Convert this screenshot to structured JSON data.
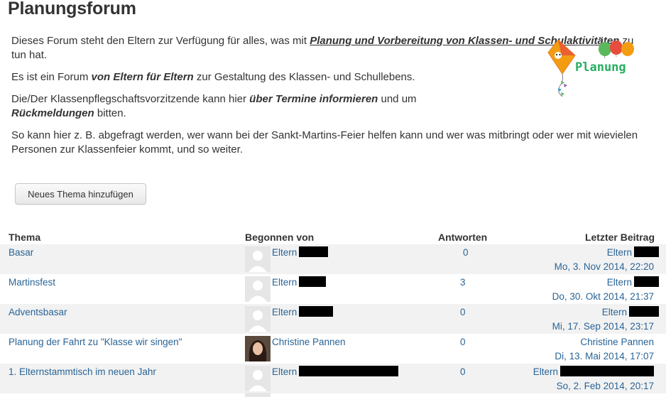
{
  "title": "Planungsforum",
  "intro": {
    "p1_a": "Dieses Forum steht den Eltern zur Verfügung für alles, was mit ",
    "p1_b": "Planung und Vorbereitung von Klassen- und Schulaktivitäten",
    "p1_c": " zu tun hat.",
    "p2_a": "Es ist ein Forum ",
    "p2_b": "von Eltern für Eltern",
    "p2_c": " zur Gestaltung des Klassen- und Schullebens.",
    "p3_a": "Die/Der Klassenpflegschaftsvorzitzende kann hier ",
    "p3_b": "über Termine informieren",
    "p3_c": " und um ",
    "p3_d": "Rückmeldungen",
    "p3_e": " bitten.",
    "p4": "So kann hier z. B. abgefragt werden, wer wann bei der Sankt-Martins-Feier helfen kann und wer was mitbringt oder wer mit wievielen Personen zur Klassenfeier kommt, und so weiter."
  },
  "logo_text": "Planung",
  "new_topic_button": "Neues Thema hinzufügen",
  "table": {
    "headers": {
      "topic": "Thema",
      "started_by": "Begonnen von",
      "replies": "Antworten",
      "last_post": "Letzter Beitrag"
    },
    "rows": [
      {
        "topic": "Basar",
        "author": "Eltern",
        "replies": "0",
        "last_author": "Eltern",
        "last_date": "Mo, 3. Nov 2014, 22:20"
      },
      {
        "topic": "Martinsfest",
        "author": "Eltern",
        "replies": "3",
        "last_author": "Eltern",
        "last_date": "Do, 30. Okt 2014, 21:37"
      },
      {
        "topic": "Adventsbasar",
        "author": "Eltern",
        "replies": "0",
        "last_author": "Eltern",
        "last_date": "Mi, 17. Sep 2014, 23:17"
      },
      {
        "topic": "Planung der Fahrt zu \"Klasse wir singen\"",
        "author": "Christine Pannen",
        "replies": "0",
        "last_author": "Christine Pannen",
        "last_date": "Di, 13. Mai 2014, 17:07"
      },
      {
        "topic": "1. Elternstammtisch im neuen Jahr",
        "author": "Eltern",
        "replies": "0",
        "last_author": "Eltern",
        "last_date": "So, 2. Feb 2014, 20:17"
      }
    ]
  },
  "colors": {
    "link": "#2a6496",
    "text": "#333333",
    "row_alt": "#f2f2f2"
  }
}
